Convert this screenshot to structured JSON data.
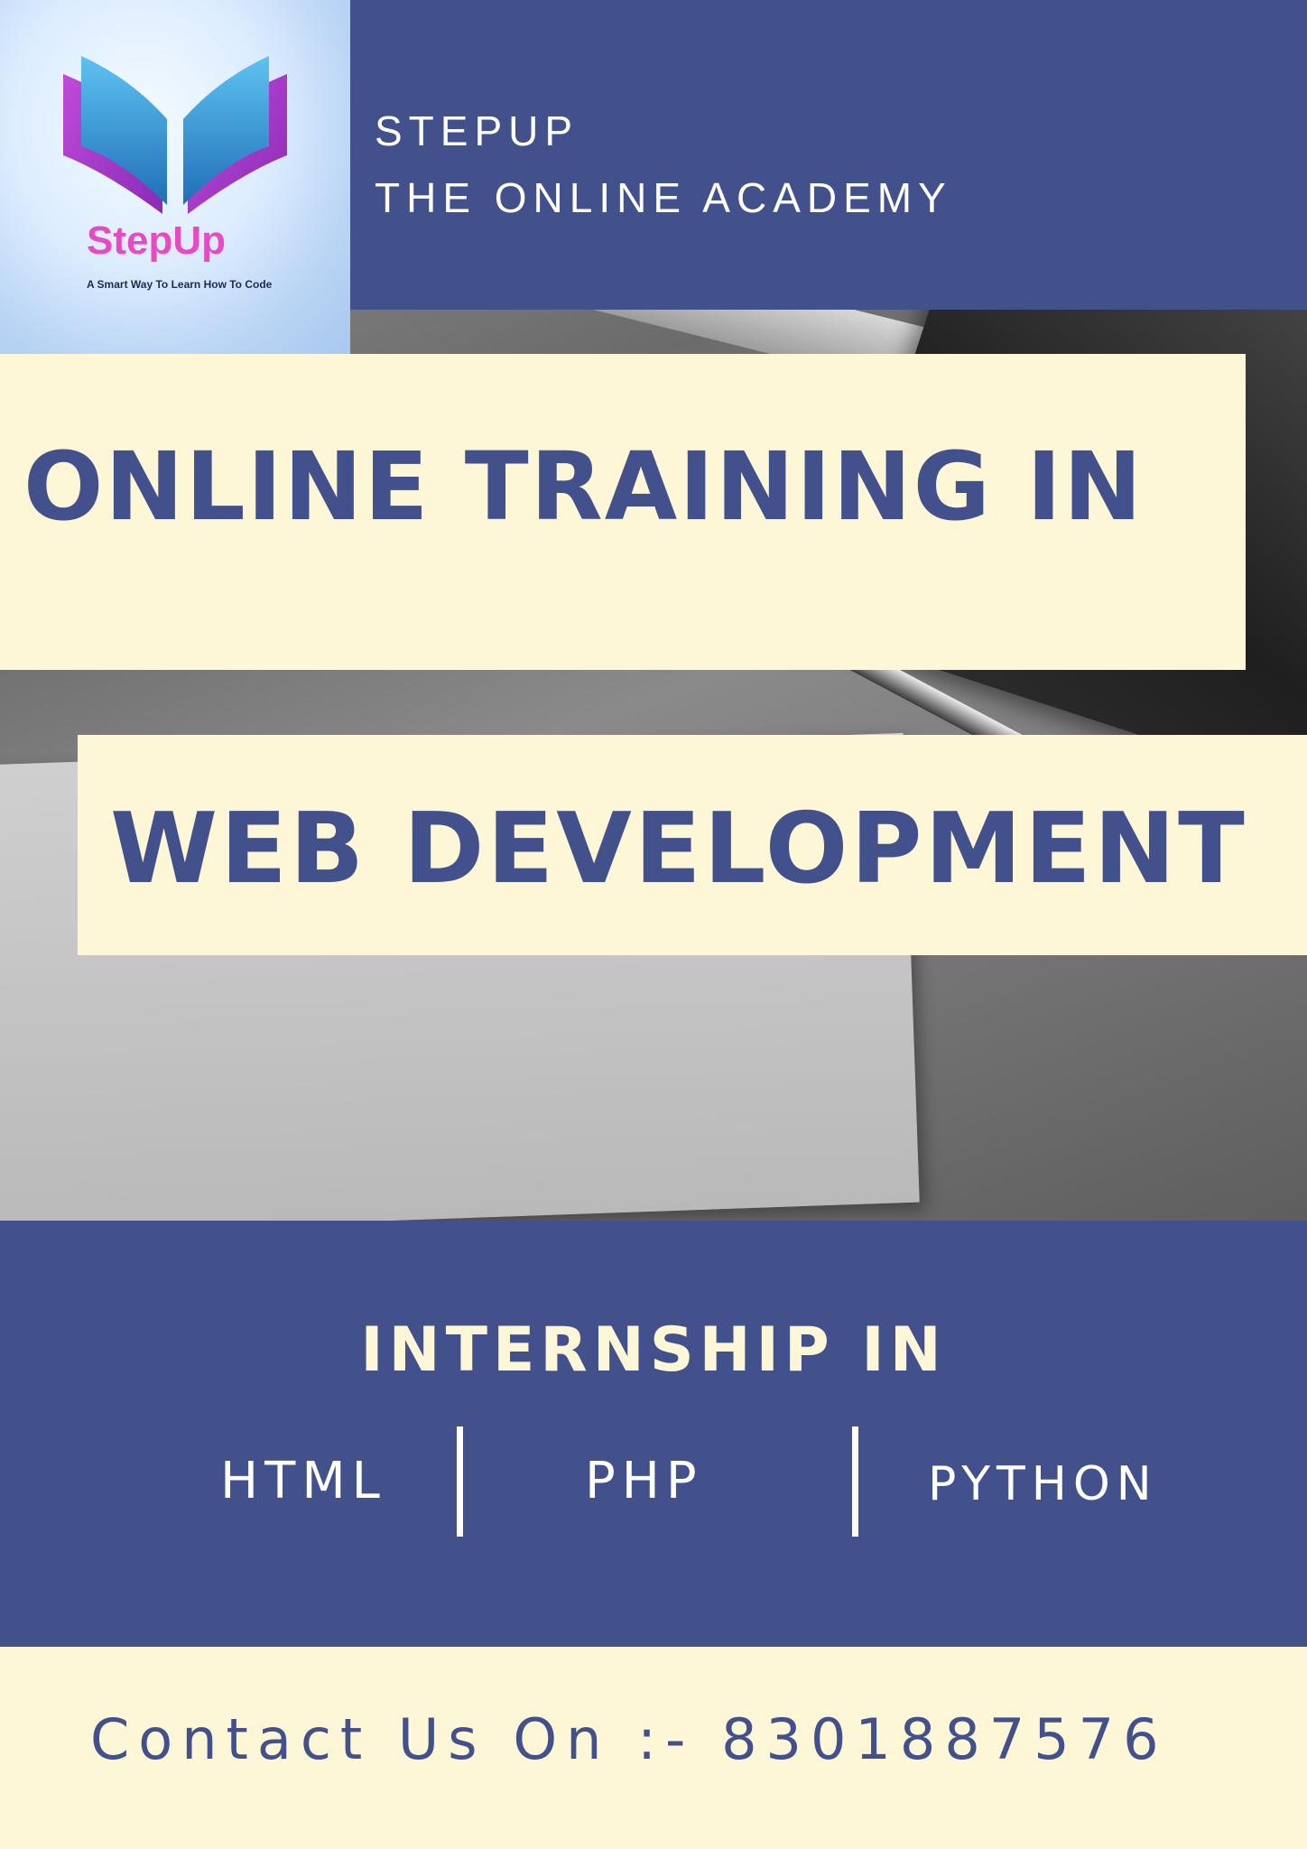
{
  "brand": {
    "logo_name": "StepUp",
    "logo_tagline": "A Smart Way To Learn How To Code",
    "academy_line1": "STEPUP",
    "academy_line2": "THE ONLINE ACADEMY"
  },
  "headline": {
    "line1": "ONLINE TRAINING IN",
    "line2": "WEB DEVELOPMENT"
  },
  "internship": {
    "title": "INTERNSHIP IN",
    "technologies": [
      "HTML",
      "PHP",
      "PYTHON"
    ]
  },
  "contact": {
    "text": "Contact Us On :- 8301887576"
  },
  "colors": {
    "navy": "#42508c",
    "cream": "#fdf7d8",
    "logo_pink": "#e64bc4",
    "logo_blue": "#2a8fd4"
  },
  "icons": [
    "open-book-logo-icon"
  ]
}
